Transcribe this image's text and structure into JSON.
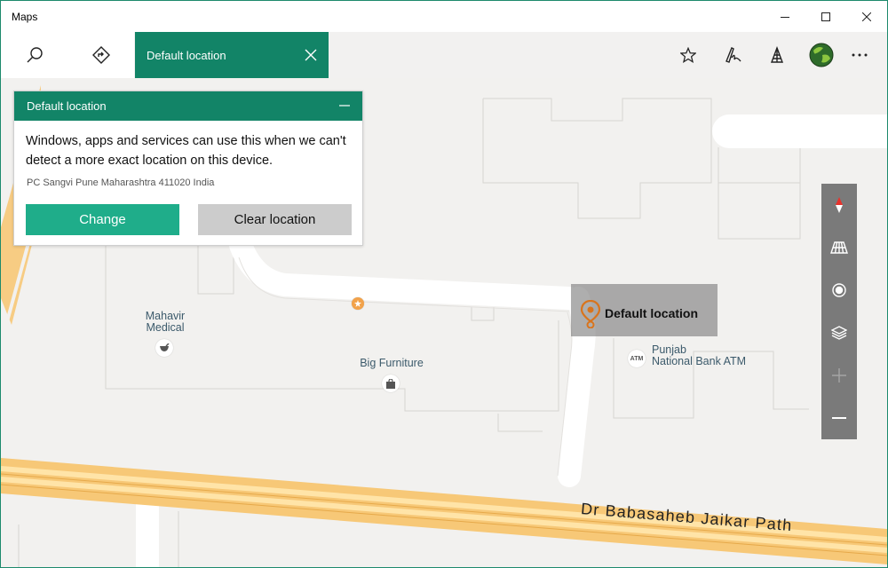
{
  "window": {
    "title": "Maps"
  },
  "toolbar": {
    "tab_label": "Default location",
    "icons": [
      "search-icon",
      "directions-icon",
      "star-icon",
      "ink-pen-icon",
      "3d-cities-icon",
      "avatar",
      "more-icon"
    ]
  },
  "panel": {
    "title": "Default location",
    "description": "Windows, apps and services can use this when we can't detect a more exact location on this device.",
    "address": "PC Sangvi Pune Maharashtra 411020 India",
    "change_label": "Change",
    "clear_label": "Clear location"
  },
  "map": {
    "pin_label": "Default location",
    "places": {
      "mahavir_medical": "Mahavir\nMedical",
      "big_furniture": "Big Furniture",
      "punjab_bank": "Punjab\nNational Bank ATM",
      "atm_badge": "ATM"
    },
    "road_name": "Dr  Babasaheb  Jaikar  Path"
  },
  "colors": {
    "accent": "#128467",
    "accent_button": "#1fad8a",
    "road_yellow": "#f7c877",
    "pin_orange": "#d9741c"
  }
}
